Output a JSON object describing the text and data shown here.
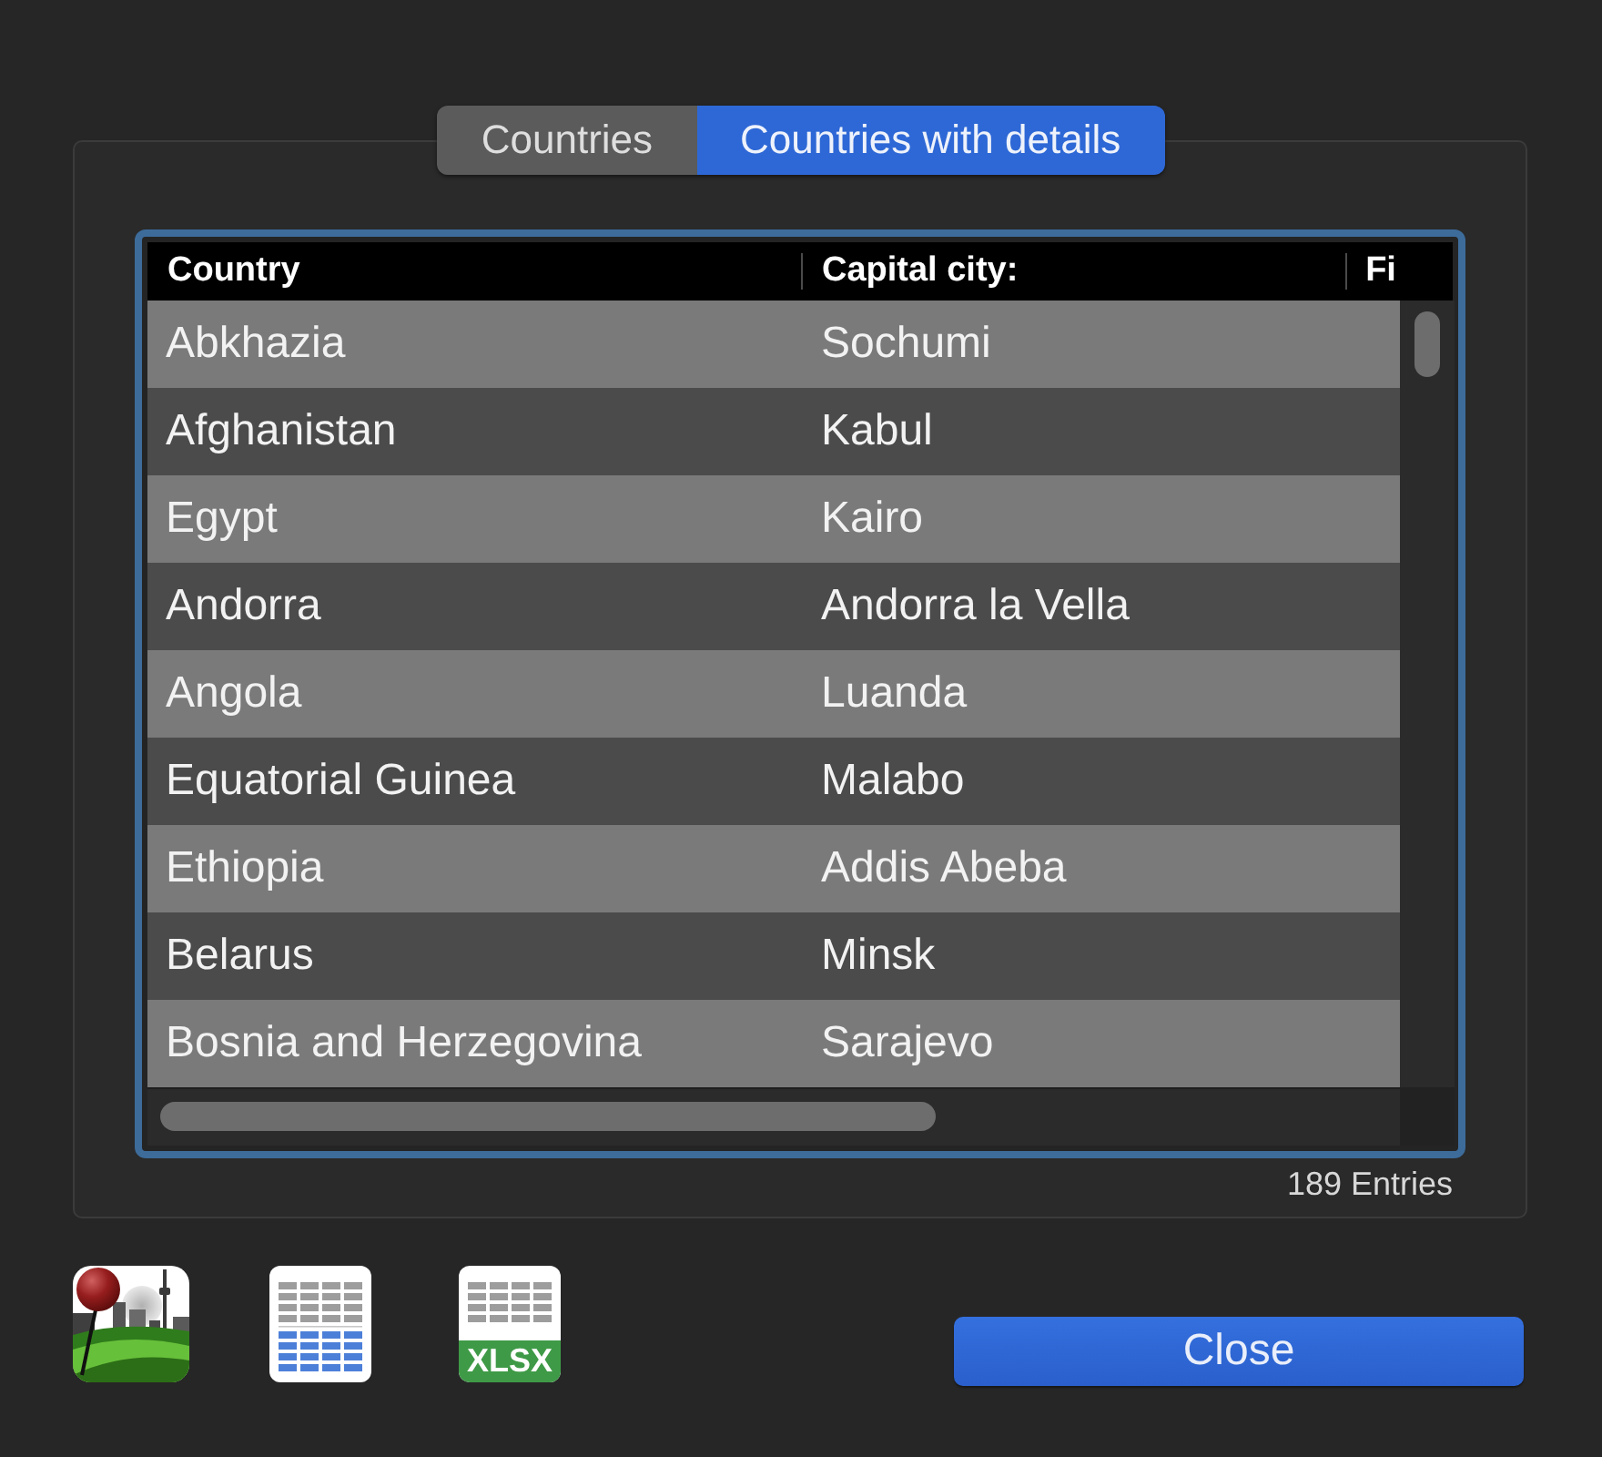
{
  "tabs": [
    {
      "label": "Countries",
      "selected": false
    },
    {
      "label": "Countries with details",
      "selected": true
    }
  ],
  "table": {
    "columns": [
      "Country",
      "Capital city:",
      "Fi"
    ],
    "rows": [
      [
        "Abkhazia",
        "Sochumi"
      ],
      [
        "Afghanistan",
        "Kabul"
      ],
      [
        "Egypt",
        "Kairo"
      ],
      [
        "Andorra",
        "Andorra la Vella"
      ],
      [
        "Angola",
        "Luanda"
      ],
      [
        "Equatorial Guinea",
        "Malabo"
      ],
      [
        "Ethiopia",
        "Addis Abeba"
      ],
      [
        "Belarus",
        "Minsk"
      ],
      [
        "Bosnia and Herzegovina",
        "Sarajevo"
      ]
    ]
  },
  "entry_count": "189 Entries",
  "tools": [
    {
      "kind": "map"
    },
    {
      "kind": "table"
    },
    {
      "kind": "xlsx",
      "label": "XLSX"
    }
  ],
  "close_button": {
    "label": "Close"
  }
}
